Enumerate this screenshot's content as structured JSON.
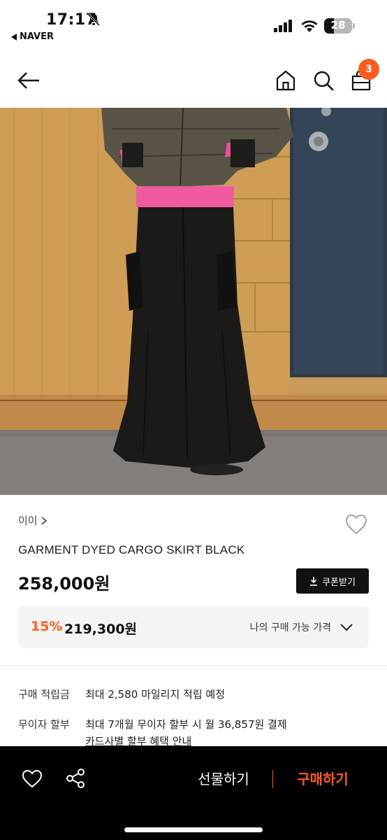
{
  "status_bar": {
    "time": "17:17",
    "back_app": "NAVER",
    "battery": "28"
  },
  "header": {
    "cart_count": "3"
  },
  "product": {
    "brand": "이이",
    "title": "GARMENT DYED CARGO SKIRT BLACK",
    "price": "258,000원",
    "coupon_label": "쿠폰받기",
    "discount_rate": "15%",
    "discount_price": "219,300원",
    "my_price_label": "나의 구매 가능 가격"
  },
  "info": {
    "points_label": "구매 적립금",
    "points_value": "최대 2,580 마일리지 적립 예정",
    "installment_label": "무이자 할부",
    "installment_value": "최대 7개월 무이자 할부 시 월 36,857원 결제",
    "installment_link": "카드사별 할부 혜택 안내"
  },
  "bottom_bar": {
    "gift_label": "선물하기",
    "buy_label": "구매하기"
  },
  "colors": {
    "accent": "#ff5a1f",
    "bottom_bar": "#000000",
    "discount_bg": "#f4f4f4"
  },
  "icons": [
    "bell-slash-icon",
    "signal-icon",
    "wifi-icon",
    "battery-icon",
    "back-arrow-icon",
    "home-icon",
    "search-icon",
    "cart-icon",
    "heart-icon",
    "chevron-right-icon",
    "download-icon",
    "chevron-down-icon",
    "share-icon"
  ]
}
